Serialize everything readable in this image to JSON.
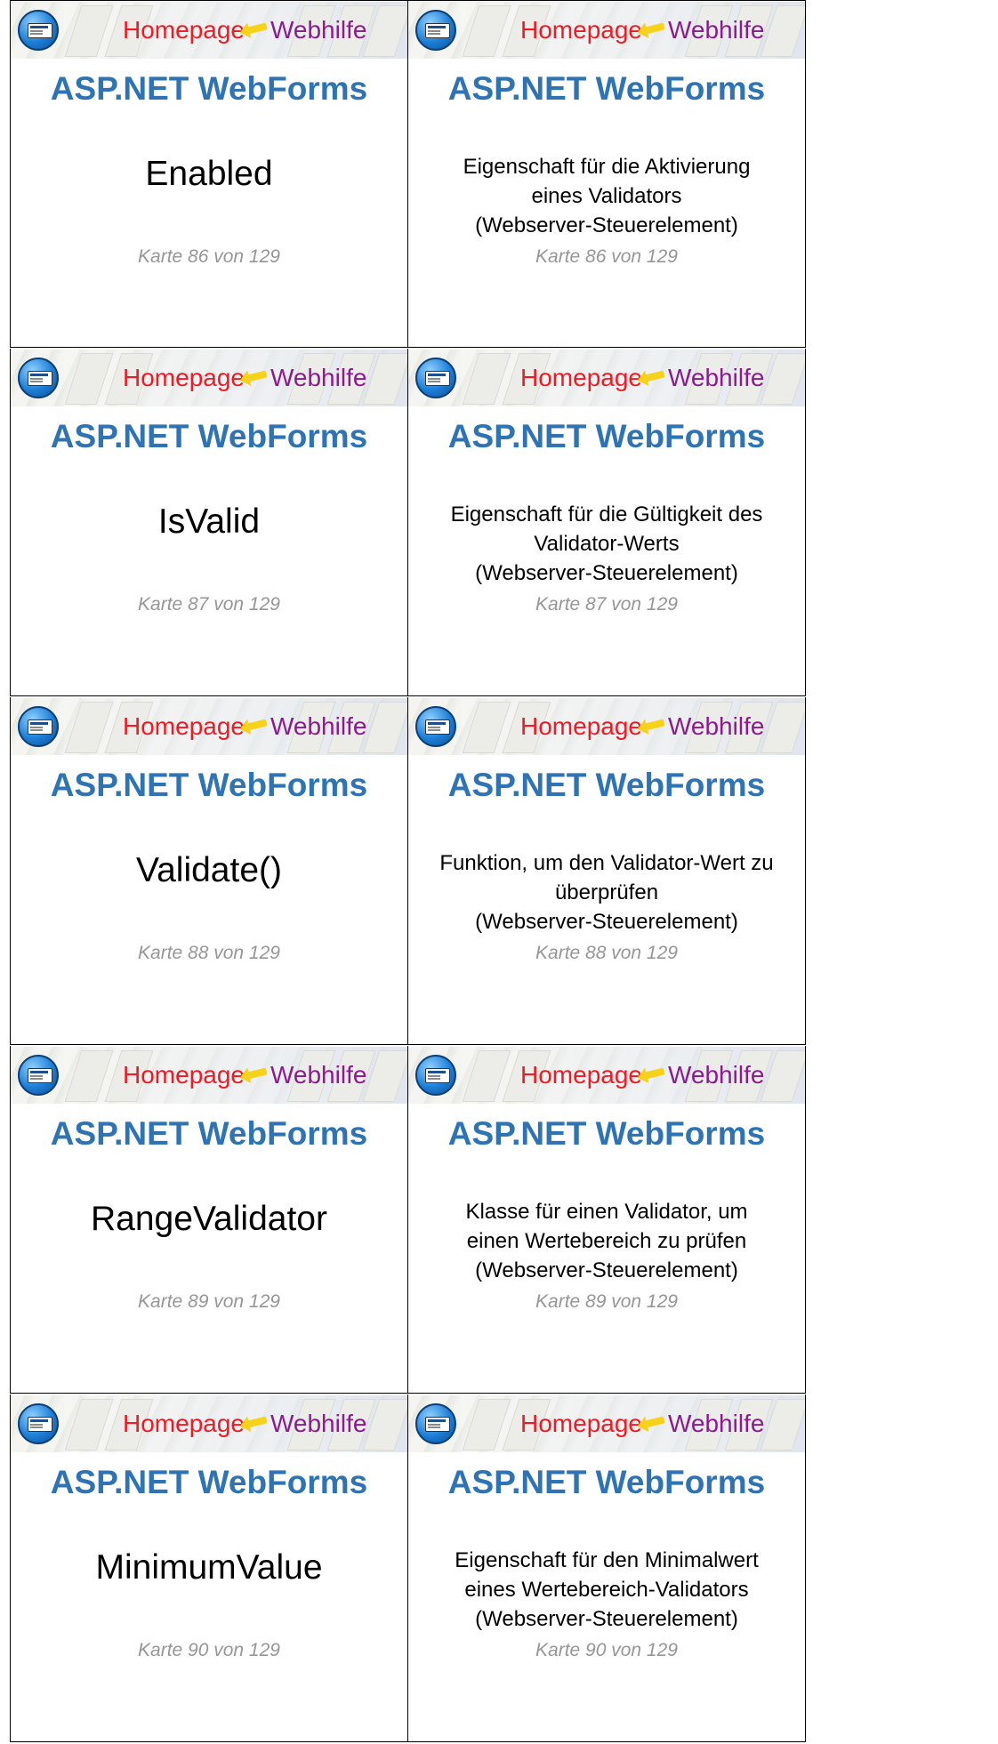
{
  "banner": {
    "homepage": "Homepage",
    "webhilfe": "Webhilfe"
  },
  "subject": "ASP.NET WebForms",
  "cards": [
    {
      "term": "Enabled",
      "definition": [
        "Eigenschaft für die Aktivierung",
        "eines Validators",
        "(Webserver-Steuerelement)"
      ],
      "label": "Karte 86 von 129"
    },
    {
      "term": "IsValid",
      "definition": [
        "Eigenschaft für die Gültigkeit des",
        "Validator-Werts",
        "(Webserver-Steuerelement)"
      ],
      "label": "Karte 87 von 129"
    },
    {
      "term": "Validate()",
      "definition": [
        "Funktion, um den Validator-Wert zu",
        "überprüfen",
        "(Webserver-Steuerelement)"
      ],
      "label": "Karte 88 von 129"
    },
    {
      "term": "RangeValidator",
      "definition": [
        "Klasse für einen Validator, um",
        "einen Wertebereich zu prüfen",
        "(Webserver-Steuerelement)"
      ],
      "label": "Karte 89 von 129"
    },
    {
      "term": "MinimumValue",
      "definition": [
        "Eigenschaft für den Minimalwert",
        "eines Wertebereich-Validators",
        "(Webserver-Steuerelement)"
      ],
      "label": "Karte 90 von 129"
    }
  ],
  "colors": {
    "title": "#2e74b5",
    "homepage": "#ee1b24",
    "webhilfe": "#8b1c8f",
    "footer": "#969696"
  }
}
